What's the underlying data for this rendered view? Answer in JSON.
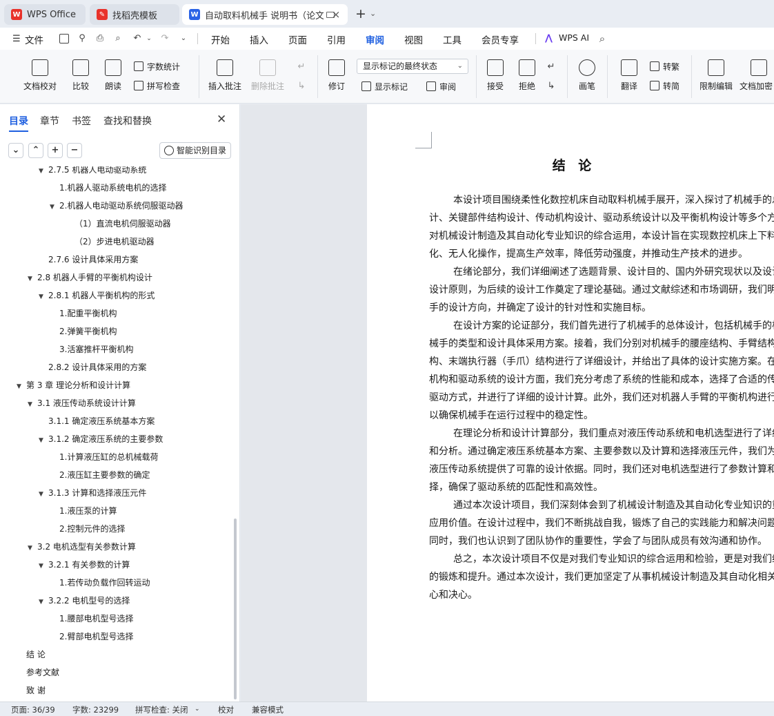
{
  "tabs": [
    {
      "label": "WPS Office",
      "icon": "wps-logo-icon"
    },
    {
      "label": "找稻壳模板",
      "icon": "docer-icon"
    },
    {
      "label": "自动取料机械手 说明书（论文",
      "icon": "word-doc-icon"
    }
  ],
  "menubar": {
    "file_label": "文件",
    "items": [
      "开始",
      "插入",
      "页面",
      "引用",
      "审阅",
      "视图",
      "工具",
      "会员专享"
    ],
    "active": "审阅",
    "ai_label": "WPS AI"
  },
  "ribbon": {
    "doc_check": "文档校对",
    "compare": "比较",
    "read_aloud": "朗读",
    "word_count": "字数统计",
    "spell_check": "拼写检查",
    "insert_comment": "插入批注",
    "delete_comment": "删除批注",
    "revise": "修订",
    "markup_state": "显示标记的最终状态",
    "show_markup": "显示标记",
    "review": "审阅",
    "accept": "接受",
    "reject": "拒绝",
    "pen": "画笔",
    "translate": "翻译",
    "to_traditional": "转繁",
    "to_simplified": "转简",
    "restrict_edit": "限制编辑",
    "doc_encrypt": "文档加密"
  },
  "sidebar": {
    "tabs": [
      "目录",
      "章节",
      "书签",
      "查找和替换"
    ],
    "active_tab": "目录",
    "smart_toc_label": "智能识别目录",
    "toc": [
      {
        "text": "2.7.5 机器人电动驱动系统",
        "level": 2,
        "expanded": true
      },
      {
        "text": "1.机器人驱动系统电机的选择",
        "level": 3
      },
      {
        "text": "2.机器人电动驱动系统伺服驱动器",
        "level": 3,
        "expanded": true
      },
      {
        "text": "（1）直流电机伺服驱动器",
        "level": 4
      },
      {
        "text": "（2）步进电机驱动器",
        "level": 4
      },
      {
        "text": "2.7.6 设计具体采用方案",
        "level": 2
      },
      {
        "text": "2.8  机器人手臂的平衡机构设计",
        "level": 1,
        "expanded": true
      },
      {
        "text": "2.8.1 机器人平衡机构的形式",
        "level": 2,
        "expanded": true
      },
      {
        "text": "1.配重平衡机构",
        "level": 3
      },
      {
        "text": "2.弹簧平衡机构",
        "level": 3
      },
      {
        "text": "3.活塞推杆平衡机构",
        "level": 3
      },
      {
        "text": "2.8.2 设计具体采用的方案",
        "level": 2
      },
      {
        "text": "第 3 章  理论分析和设计计算",
        "level": 0,
        "expanded": true
      },
      {
        "text": "3.1 液压传动系统设计计算",
        "level": 1,
        "expanded": true
      },
      {
        "text": "3.1.1 确定液压系统基本方案",
        "level": 2
      },
      {
        "text": "3.1.2 确定液压系统的主要参数",
        "level": 2,
        "expanded": true
      },
      {
        "text": "1.计算液压缸的总机械载荷",
        "level": 3
      },
      {
        "text": "2.液压缸主要参数的确定",
        "level": 3
      },
      {
        "text": "3.1.3 计算和选择液压元件",
        "level": 2,
        "expanded": true
      },
      {
        "text": "1.液压泵的计算",
        "level": 3
      },
      {
        "text": "2.控制元件的选择",
        "level": 3
      },
      {
        "text": "3.2  电机选型有关参数计算",
        "level": 1,
        "expanded": true
      },
      {
        "text": "3.2.1 有关参数的计算",
        "level": 2,
        "expanded": true
      },
      {
        "text": "1.若传动负载作回转运动",
        "level": 3
      },
      {
        "text": "3.2.2 电机型号的选择",
        "level": 2,
        "expanded": true
      },
      {
        "text": "1.腰部电机型号选择",
        "level": 3
      },
      {
        "text": "2.臂部电机型号选择",
        "level": 3
      },
      {
        "text": "结  论",
        "level": 0
      },
      {
        "text": "参考文献",
        "level": 0
      },
      {
        "text": "致  谢",
        "level": 0
      }
    ]
  },
  "document": {
    "title": "结  论",
    "paragraphs": [
      "本设计项目围绕柔性化数控机床自动取料机械手展开，深入探讨了机械手的总体设计、关键部件结构设计、传动机构设计、驱动系统设计以及平衡机构设计等多个方面。通过对机械设计制造及其自动化专业知识的综合运用，本设计旨在实现数控机床上下料的自动化、无人化操作，提高生产效率，降低劳动强度，并推动生产技术的进步。",
      "在绪论部分，我们详细阐述了选题背景、设计目的、国内外研究现状以及设计要求和设计原则，为后续的设计工作奠定了理论基础。通过文献综述和市场调研，我们明确了机械手的设计方向，并确定了设计的针对性和实施目标。",
      "在设计方案的论证部分，我们首先进行了机械手的总体设计，包括机械手的构成、机械手的类型和设计具体采用方案。接着，我们分别对机械手的腰座结构、手臂结构、手腕结构、末端执行器（手爪）结构进行了详细设计，并给出了具体的设计实施方案。在机械传动机构和驱动系统的设计方面，我们充分考虑了系统的性能和成本，选择了合适的传动机构和驱动方式，并进行了详细的设计计算。此外，我们还对机器人手臂的平衡机构进行了设计，以确保机械手在运行过程中的稳定性。",
      "在理论分析和设计计算部分，我们重点对液压传动系统和电机选型进行了详细的计算和分析。通过确定液压系统基本方案、主要参数以及计算和选择液压元件，我们为机械手的液压传动系统提供了可靠的设计依据。同时，我们还对电机选型进行了参数计算和型号选择，确保了驱动系统的匹配性和高效性。",
      "通过本次设计项目，我们深刻体会到了机械设计制造及其自动化专业知识的重要性和应用价值。在设计过程中，我们不断挑战自我，锻炼了自己的实践能力和解决问题的能力。同时，我们也认识到了团队协作的重要性，学会了与团队成员有效沟通和协作。",
      "总之，本次设计项目不仅是对我们专业知识的综合运用和检验，更是对我们综合素质的锻炼和提升。通过本次设计，我们更加坚定了从事机械设计制造及其自动化相关工作的信心和决心。"
    ]
  },
  "statusbar": {
    "page": "页面: 36/39",
    "words": "字数: 23299",
    "spell": "拼写检查: 关闭",
    "proof": "校对",
    "compat": "兼容模式"
  },
  "colors": {
    "accent": "#1e5fe0",
    "wps_red": "#e8322b",
    "doc_blue": "#2b63e6"
  }
}
